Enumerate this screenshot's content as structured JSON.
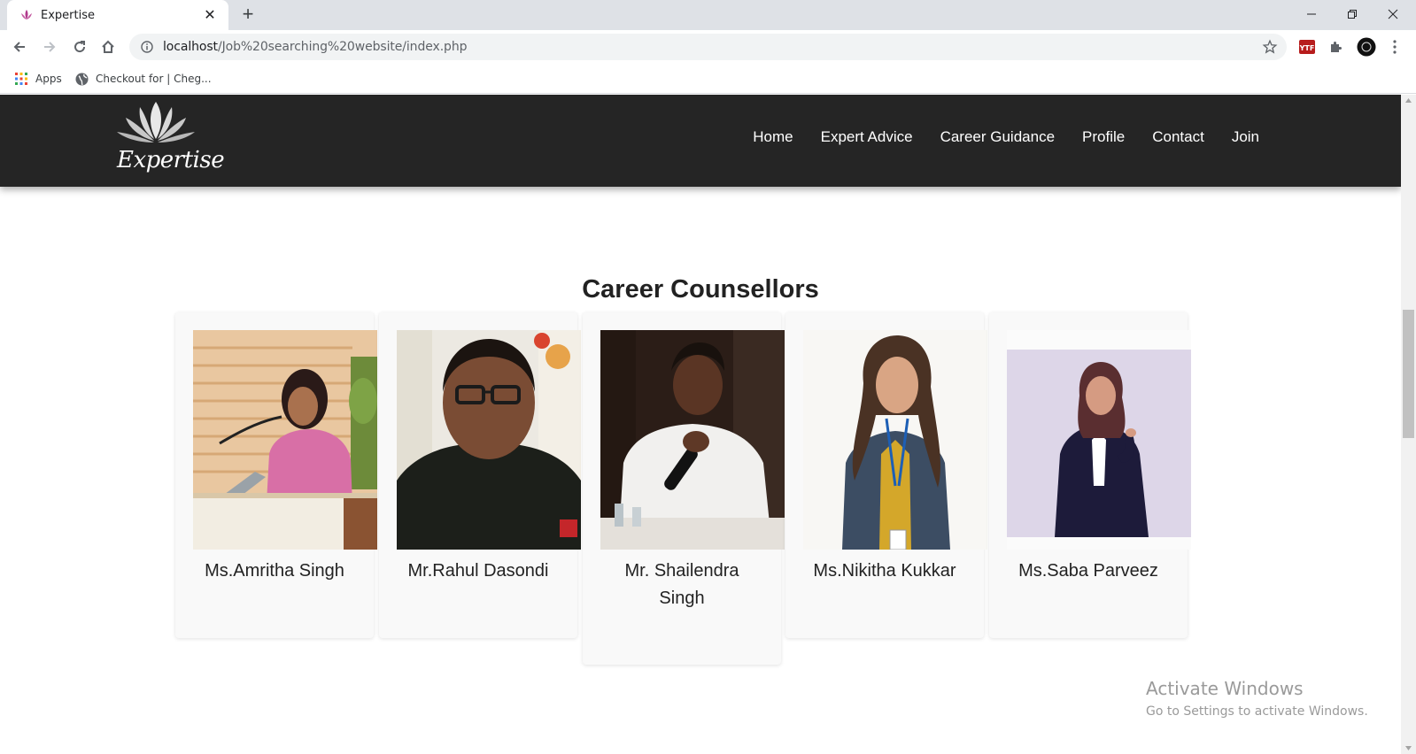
{
  "browser": {
    "tab_title": "Expertise",
    "url_host": "localhost",
    "url_path": "/Job%20searching%20website/index.php",
    "bookmarks": [
      {
        "label": "Apps",
        "icon": "apps-grid-icon"
      },
      {
        "label": "Checkout for | Cheg...",
        "icon": "globe-icon"
      }
    ],
    "extensions": [
      "ytf-extension-icon",
      "puzzle-extensions-icon",
      "profile-avatar-icon"
    ],
    "window_controls": [
      "minimize",
      "restore",
      "close"
    ]
  },
  "site": {
    "brand": "Expertise",
    "nav": [
      "Home",
      "Expert Advice",
      "Career Guidance",
      "Profile",
      "Contact",
      "Join"
    ]
  },
  "section": {
    "title": "Career Counsellors",
    "counsellors": [
      {
        "name": "Ms.Amritha Singh"
      },
      {
        "name": "Mr.Rahul Dasondi"
      },
      {
        "name": "Mr. Shailendra Singh"
      },
      {
        "name": "Ms.Nikitha Kukkar"
      },
      {
        "name": "Ms.Saba Parveez"
      }
    ]
  },
  "watermark": {
    "line1": "Activate Windows",
    "line2": "Go to Settings to activate Windows."
  },
  "colors": {
    "nav_bg": "#252525",
    "card_bg": "#f9f9f9",
    "tabstrip": "#dee1e6"
  }
}
